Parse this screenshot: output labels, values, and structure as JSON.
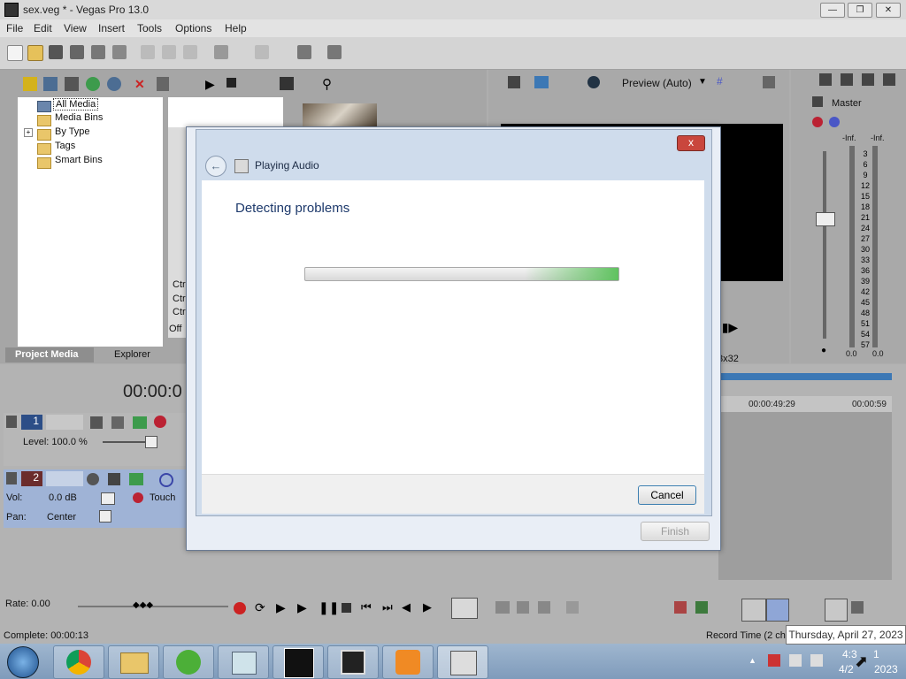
{
  "window": {
    "title": "sex.veg * - Vegas Pro 13.0"
  },
  "menu": [
    "File",
    "Edit",
    "View",
    "Insert",
    "Tools",
    "Options",
    "Help"
  ],
  "explorer_tree": [
    "All Media",
    "Media Bins",
    "By Type",
    "Tags",
    "Smart Bins"
  ],
  "tree_expander": "+",
  "left_tabs": {
    "project_media": "Project Media",
    "explorer": "Explorer"
  },
  "media_panel": {
    "ctr1": "Ctr",
    "ctr2": "Ctr",
    "ctr3": "Ctr",
    "off": "Off"
  },
  "preview": {
    "mode": "Preview (Auto)",
    "res": "8x32"
  },
  "mixer": {
    "master": "Master",
    "inf_left": "-Inf.",
    "inf_right": "-Inf.",
    "val_left": "0.0",
    "val_right": "0.0",
    "scale": [
      "3",
      "6",
      "9",
      "12",
      "15",
      "18",
      "21",
      "24",
      "27",
      "30",
      "33",
      "36",
      "39",
      "42",
      "45",
      "48",
      "51",
      "54",
      "57"
    ]
  },
  "timeline": {
    "timecode": "00:00:0",
    "ruler1": "00:00:49:29",
    "ruler2": "00:00:59"
  },
  "track1": {
    "number": "1",
    "level": "Level: 100.0 %"
  },
  "track2": {
    "number": "2",
    "vol_label": "Vol:",
    "vol_value": "0.0 dB",
    "touch": "Touch",
    "pan_label": "Pan:",
    "pan_value": "Center"
  },
  "transport": {
    "rate": "Rate: 0.00"
  },
  "status": {
    "complete": "Complete: 00:00:13",
    "record_time": "Record Time (2 cha"
  },
  "dialog": {
    "title": "Playing Audio",
    "heading": "Detecting problems",
    "progress": 1.0,
    "cancel": "Cancel",
    "finish": "Finish",
    "close": "x"
  },
  "taskbar": {
    "time": "4:3",
    "date": "4/2",
    "time_partial": "1",
    "date_partial": "2023",
    "tooltip": "Thursday, April 27, 2023"
  }
}
